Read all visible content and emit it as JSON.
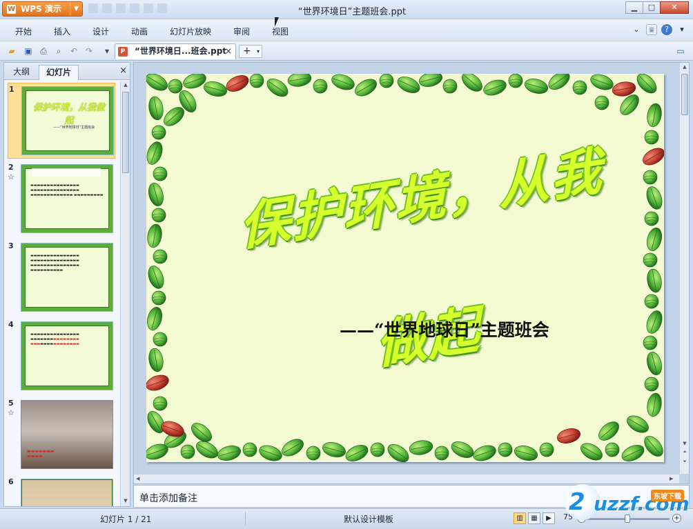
{
  "app": {
    "button_label": "WPS 演示",
    "window_title": "“世界环境日”主题班会.ppt"
  },
  "menu": {
    "items": [
      "开始",
      "插入",
      "设计",
      "动画",
      "幻灯片放映",
      "审阅",
      "视图"
    ]
  },
  "tabs": {
    "doc_name": "“世界环境日...班会.ppt",
    "close": "×",
    "new": "+"
  },
  "panel": {
    "tab_outline": "大纲",
    "tab_slides": "幻灯片",
    "close": "×"
  },
  "thumbnails": [
    {
      "num": "1",
      "title": "保护环境，从我做起",
      "subtitle": "——“世界地球日”主题班会"
    },
    {
      "num": "2",
      "star": "☆"
    },
    {
      "num": "3"
    },
    {
      "num": "4"
    },
    {
      "num": "5",
      "star": "☆"
    },
    {
      "num": "6"
    }
  ],
  "slide": {
    "title": "保护环境，从我做起",
    "subtitle": "——“世界地球日”主题班会"
  },
  "notes": {
    "placeholder": "单击添加备注"
  },
  "status": {
    "slide_counter": "幻灯片 1 / 21",
    "template": "默认设计模板",
    "zoom": "75 %"
  },
  "watermark": {
    "brand": "uzzf.com",
    "tag": "东坡下载"
  },
  "colors": {
    "accent": "#e2731a",
    "title_fill": "#d6ff2e",
    "slide_bg": "#f3fad2"
  }
}
